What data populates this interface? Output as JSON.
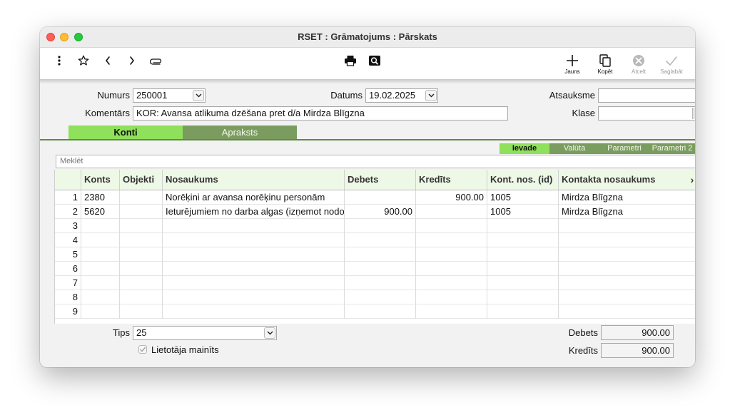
{
  "window": {
    "title": "RSET : Grāmatojums : Pārskats"
  },
  "toolbar": {
    "new_label": "Jauns",
    "copy_label": "Kopēt",
    "cancel_label": "Atcelt",
    "save_label": "Saglabāt"
  },
  "form": {
    "number_label": "Numurs",
    "number_value": "250001",
    "date_label": "Datums",
    "date_value": "19.02.2025",
    "reference_label": "Atsauksme",
    "reference_value": "",
    "comment_label": "Komentārs",
    "comment_value": "KOR: Avansa atlikuma dzēšana pret d/a Mirdza Blīgzna",
    "class_label": "Klase",
    "class_value": ""
  },
  "tabs": [
    {
      "label": "Konti",
      "active": true
    },
    {
      "label": "Apraksts",
      "active": false
    }
  ],
  "subtabs": [
    {
      "label": "Ievade",
      "active": true
    },
    {
      "label": "Valūta",
      "active": false
    },
    {
      "label": "Parametri",
      "active": false
    },
    {
      "label": "Parametri 2",
      "active": false
    }
  ],
  "search": {
    "placeholder": "Meklēt"
  },
  "grid": {
    "columns": [
      "Konts",
      "Objekti",
      "Nosaukums",
      "Debets",
      "Kredīts",
      "Kont. nos. (id)",
      "Kontakta nosaukums"
    ],
    "more_glyph": "›",
    "rows": [
      {
        "n": "1",
        "konts": "2380",
        "objekti": "",
        "nosaukums": "Norēķini ar avansa norēķinu personām",
        "debets": "",
        "kredits": "900.00",
        "kont_id": "1005",
        "kontakts": "Mirdza Blīgzna"
      },
      {
        "n": "2",
        "konts": "5620",
        "objekti": "",
        "nosaukums": "Ieturējumiem no darba algas (izņemot nodo",
        "debets": "900.00",
        "kredits": "",
        "kont_id": "1005",
        "kontakts": "Mirdza Blīgzna"
      },
      {
        "n": "3",
        "konts": "",
        "objekti": "",
        "nosaukums": "",
        "debets": "",
        "kredits": "",
        "kont_id": "",
        "kontakts": ""
      },
      {
        "n": "4",
        "konts": "",
        "objekti": "",
        "nosaukums": "",
        "debets": "",
        "kredits": "",
        "kont_id": "",
        "kontakts": ""
      },
      {
        "n": "5",
        "konts": "",
        "objekti": "",
        "nosaukums": "",
        "debets": "",
        "kredits": "",
        "kont_id": "",
        "kontakts": ""
      },
      {
        "n": "6",
        "konts": "",
        "objekti": "",
        "nosaukums": "",
        "debets": "",
        "kredits": "",
        "kont_id": "",
        "kontakts": ""
      },
      {
        "n": "7",
        "konts": "",
        "objekti": "",
        "nosaukums": "",
        "debets": "",
        "kredits": "",
        "kont_id": "",
        "kontakts": ""
      },
      {
        "n": "8",
        "konts": "",
        "objekti": "",
        "nosaukums": "",
        "debets": "",
        "kredits": "",
        "kont_id": "",
        "kontakts": ""
      },
      {
        "n": "9",
        "konts": "",
        "objekti": "",
        "nosaukums": "",
        "debets": "",
        "kredits": "",
        "kont_id": "",
        "kontakts": ""
      }
    ]
  },
  "bottom": {
    "type_label": "Tips",
    "type_value": "25",
    "user_changed_label": "Lietotāja mainīts",
    "debit_label": "Debets",
    "debit_value": "900.00",
    "credit_label": "Kredīts",
    "credit_value": "900.00"
  },
  "colors": {
    "tab_active": "#8fe05a",
    "tab_inactive": "#7b9c5f",
    "header_bg": "#eef8e6"
  }
}
